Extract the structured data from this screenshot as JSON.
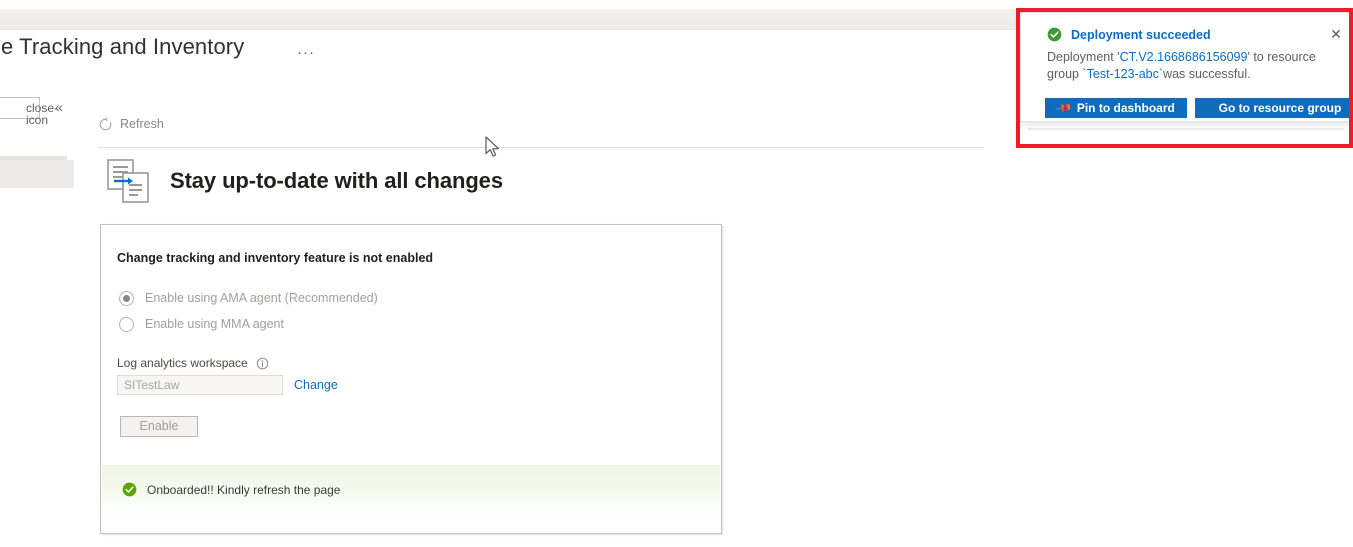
{
  "page": {
    "title": "ange Tracking and Inventory",
    "title_full": "Change Tracking and Inventory",
    "more_ellipsis": "···"
  },
  "rail": {
    "search_clear_icon": "close-icon",
    "collapse_icon": "«"
  },
  "command_bar": {
    "refresh_label": "Refresh",
    "refresh_icon": "refresh-icon"
  },
  "hero": {
    "icon": "change-tracking-icon",
    "title": "Stay up-to-date with all changes"
  },
  "card": {
    "heading": "Change tracking and inventory feature is not enabled",
    "radios": [
      {
        "label": "Enable using AMA agent (Recommended)",
        "checked": true,
        "disabled": true
      },
      {
        "label": "Enable using MMA agent",
        "checked": false,
        "disabled": true
      }
    ],
    "workspace": {
      "label": "Log analytics workspace",
      "info_icon": "info-icon",
      "value": "SITestLaw",
      "change_link": "Change"
    },
    "enable_button": "Enable",
    "success": {
      "icon": "success-check-icon",
      "text": "Onboarded!! Kindly refresh the page",
      "color": "#5ca400",
      "background": "#f0f6e6"
    }
  },
  "notification": {
    "icon": "success-check-icon",
    "title": "Deployment succeeded",
    "close_icon": "close-icon",
    "body_prefix": "Deployment '",
    "deployment_name": "CT.V2.1668686156099",
    "body_middle": "' to resource group ",
    "resource_group": "`Test-123-abc`",
    "body_suffix": "was successful.",
    "pin_button": "Pin to dashboard",
    "pin_icon": "pin-icon",
    "goto_button": "Go to resource group",
    "accent_color": "#0f6cbd",
    "highlight_color": "#ee1c24"
  }
}
